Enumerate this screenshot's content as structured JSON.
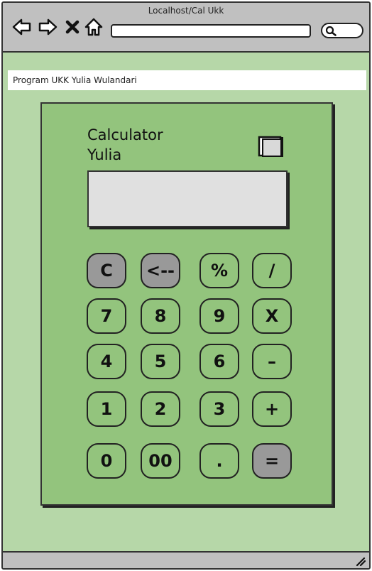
{
  "browser": {
    "title": "Localhost/Cal Ukk",
    "address_value": ""
  },
  "app": {
    "caption": "Program UKK Yulia Wulandari"
  },
  "calculator": {
    "title_line1": "Calculator",
    "title_line2": "Yulia",
    "display_value": "",
    "keys": [
      {
        "label": "C",
        "style": "dark"
      },
      {
        "label": "<--",
        "style": "dark"
      },
      {
        "label": "%",
        "style": "normal"
      },
      {
        "label": "/",
        "style": "normal"
      },
      {
        "label": "7",
        "style": "normal"
      },
      {
        "label": "8",
        "style": "normal"
      },
      {
        "label": "9",
        "style": "normal"
      },
      {
        "label": "X",
        "style": "normal"
      },
      {
        "label": "4",
        "style": "normal"
      },
      {
        "label": "5",
        "style": "normal"
      },
      {
        "label": "6",
        "style": "normal"
      },
      {
        "label": "–",
        "style": "normal"
      },
      {
        "label": "1",
        "style": "normal"
      },
      {
        "label": "2",
        "style": "normal"
      },
      {
        "label": "3",
        "style": "normal"
      },
      {
        "label": "+",
        "style": "normal"
      },
      {
        "label": "0",
        "style": "normal"
      },
      {
        "label": "00",
        "style": "normal"
      },
      {
        "label": ".",
        "style": "normal"
      },
      {
        "label": "=",
        "style": "dark"
      }
    ]
  },
  "icons": {
    "back": "arrow-left-icon",
    "forward": "arrow-right-icon",
    "stop": "close-icon",
    "home": "home-icon",
    "search": "search-icon",
    "window": "window-icon",
    "resize": "resize-grip-icon"
  },
  "colors": {
    "page_background": "#b6d7a8",
    "calculator_body": "#93c47d",
    "display": "#e0e0e0",
    "dark_key": "#999999",
    "chrome": "#c0c0c0"
  }
}
